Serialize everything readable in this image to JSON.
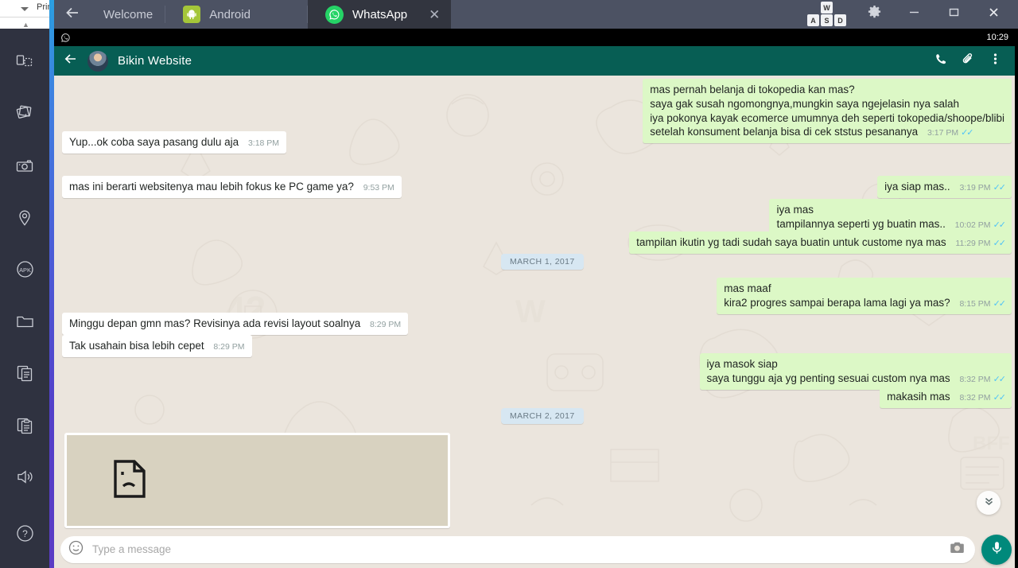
{
  "desktop": {
    "print_label": "Prin",
    "caret_icon": "caret-down-icon"
  },
  "sidebar": {
    "items": [
      {
        "name": "multi-screen-icon",
        "label": "Multi Screen"
      },
      {
        "name": "gallery-icon",
        "label": "Gallery"
      },
      {
        "name": "camera-icon",
        "label": "Screenshot"
      },
      {
        "name": "location-icon",
        "label": "Location"
      },
      {
        "name": "apk-icon",
        "label": "APK"
      },
      {
        "name": "folder-icon",
        "label": "Shared Folder"
      },
      {
        "name": "copy-icon",
        "label": "Copy"
      },
      {
        "name": "clipboard-icon",
        "label": "Paste"
      },
      {
        "name": "volume-icon",
        "label": "Volume"
      },
      {
        "name": "help-icon",
        "label": "Help"
      }
    ]
  },
  "titlebar": {
    "back_icon": "back-arrow-icon",
    "tabs": [
      {
        "label": "Welcome",
        "icon": "none",
        "active": false,
        "closable": false
      },
      {
        "label": "Android",
        "icon": "android-icon",
        "active": false,
        "closable": false
      },
      {
        "label": "WhatsApp",
        "icon": "whatsapp-icon",
        "active": true,
        "closable": true
      }
    ],
    "close_tab_label": "✕",
    "keys": [
      "W",
      "A",
      "S",
      "D"
    ],
    "controls": [
      {
        "name": "keymap-button",
        "label": "WASD"
      },
      {
        "name": "settings-button",
        "label": "gear-icon"
      },
      {
        "name": "minimize-button",
        "label": "minimize-icon"
      },
      {
        "name": "maximize-button",
        "label": "maximize-icon"
      },
      {
        "name": "close-button",
        "label": "close-icon"
      }
    ]
  },
  "statusbar": {
    "notification_icon": "whatsapp-notification-icon",
    "time": "10:29"
  },
  "chat_header": {
    "back_icon": "back-arrow-icon",
    "title": "Bikin Website",
    "actions": [
      {
        "name": "call-icon",
        "label": "Call"
      },
      {
        "name": "attach-icon",
        "label": "Attach"
      },
      {
        "name": "overflow-menu-icon",
        "label": "More options"
      }
    ]
  },
  "conversation": [
    {
      "type": "message",
      "direction": "out",
      "lines": [
        "mas pernah belanja di tokopedia kan mas?",
        "saya gak susah ngomongnya,mungkin saya ngejelasin nya salah",
        "iya pokonya kayak ecomerce umumnya deh seperti tokopedia/shoope/blibi",
        "setelah konsument belanja bisa di cek ststus pesananya"
      ],
      "time": "3:17 PM",
      "status": "read"
    },
    {
      "type": "message",
      "direction": "in",
      "lines": [
        "Yup...ok coba saya pasang dulu aja"
      ],
      "time": "3:18 PM",
      "status": "none"
    },
    {
      "type": "message",
      "direction": "out",
      "lines": [
        "iya siap mas.."
      ],
      "time": "3:19 PM",
      "status": "read"
    },
    {
      "type": "message",
      "direction": "in",
      "lines": [
        "mas ini berarti websitenya mau lebih fokus ke PC game ya?"
      ],
      "time": "9:53 PM",
      "status": "none"
    },
    {
      "type": "message",
      "direction": "out",
      "lines": [
        "iya mas",
        "tampilannya seperti yg buatin mas.."
      ],
      "time": "10:02 PM",
      "status": "read"
    },
    {
      "type": "message",
      "direction": "out",
      "lines": [
        "tampilan ikutin yg tadi sudah saya buatin untuk custome nya mas"
      ],
      "time": "11:29 PM",
      "status": "read"
    },
    {
      "type": "date",
      "label": "MARCH 1, 2017"
    },
    {
      "type": "message",
      "direction": "out",
      "lines": [
        "mas maaf",
        "kira2 progres sampai berapa lama lagi ya mas?"
      ],
      "time": "8:15 PM",
      "status": "read"
    },
    {
      "type": "message",
      "direction": "in",
      "lines": [
        "Minggu depan gmn mas? Revisinya ada revisi layout soalnya"
      ],
      "time": "8:29 PM",
      "status": "none"
    },
    {
      "type": "message",
      "direction": "in",
      "lines": [
        "Tak usahain bisa lebih cepet"
      ],
      "time": "8:29 PM",
      "status": "none"
    },
    {
      "type": "message",
      "direction": "out",
      "lines": [
        "iya masok siap",
        "saya tunggu aja yg penting sesuai custom nya mas"
      ],
      "time": "8:32 PM",
      "status": "read"
    },
    {
      "type": "message",
      "direction": "out",
      "lines": [
        "makasih mas"
      ],
      "time": "8:32 PM",
      "status": "read"
    },
    {
      "type": "date",
      "label": "MARCH 2, 2017"
    },
    {
      "type": "image",
      "direction": "in",
      "icon": "broken-image-icon",
      "alt": "broken image placeholder"
    }
  ],
  "composer": {
    "emoji_icon": "emoji-smiley-icon",
    "placeholder": "Type a message",
    "value": "",
    "camera_icon": "camera-icon",
    "mic_icon": "microphone-icon"
  },
  "scroll_button": {
    "icon": "chevron-double-down-icon"
  },
  "colors": {
    "titlebar": "#4c5263",
    "tab_active": "#32353f",
    "whatsapp_header": "#075e54",
    "chat_bg": "#ebe5dd",
    "bubble_out": "#dcf8c6",
    "bubble_in": "#ffffff",
    "date_pill": "#d7e7f2",
    "mic_button": "#00897b",
    "tick_blue": "#4fc3f7",
    "sidebar": "#2f3240"
  }
}
